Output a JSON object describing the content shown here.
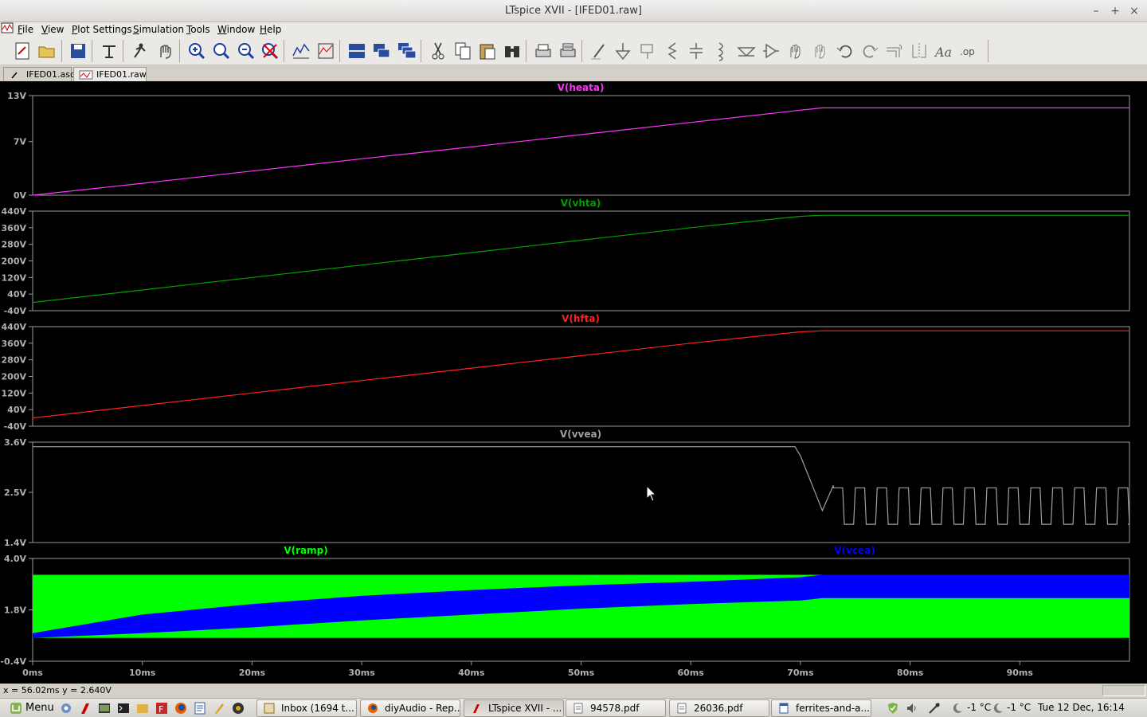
{
  "window": {
    "title": "LTspice XVII - [IFED01.raw]",
    "controls": [
      "–",
      "+",
      "×"
    ]
  },
  "menu": [
    "File",
    "View",
    "Plot Settings",
    "Simulation",
    "Tools",
    "Window",
    "Help"
  ],
  "tabs": [
    {
      "label": "IFED01.asc",
      "icon": "schematic-icon",
      "active": false
    },
    {
      "label": "IFED01.raw",
      "icon": "waveform-icon",
      "active": true
    }
  ],
  "toolbar_icons": [
    "new-schematic-icon",
    "open-icon",
    "save-icon",
    "control-panel-icon",
    "run-icon",
    "halt-icon",
    "zoom-in-icon",
    "zoom-area-icon",
    "zoom-out-icon",
    "zoom-fit-icon",
    "autorange-icon",
    "pick-traces-icon",
    "tile-horizontal-icon",
    "tile-vertical-icon",
    "cascade-icon",
    "cut-icon",
    "copy-icon",
    "paste-icon",
    "find-icon",
    "print-setup-icon",
    "print-icon",
    "wire-icon",
    "ground-icon",
    "label-net-icon",
    "resistor-icon",
    "capacitor-icon",
    "inductor-icon",
    "diode-icon",
    "component-icon",
    "move-icon",
    "drag-icon",
    "undo-icon",
    "redo-icon",
    "rotate-icon",
    "mirror-icon",
    "text-icon",
    "spice-directive-icon"
  ],
  "chart_data": [
    {
      "type": "line",
      "title": "V(heata)",
      "series": [
        {
          "name": "V(heata)",
          "color": "#ff33ff",
          "x": [
            0,
            10,
            20,
            30,
            40,
            50,
            60,
            70,
            72,
            100
          ],
          "y": [
            0,
            1.55,
            3.15,
            4.75,
            6.3,
            7.9,
            9.5,
            11.1,
            11.4,
            11.4
          ]
        }
      ],
      "ylim": [
        0,
        13
      ],
      "yticks": [
        "13V",
        "7V",
        "0V"
      ],
      "ytick_values": [
        13,
        7,
        0
      ],
      "xlim": [
        0,
        100
      ]
    },
    {
      "type": "line",
      "title": "V(vhta)",
      "series": [
        {
          "name": "V(vhta)",
          "color": "#00a000",
          "x": [
            0,
            10,
            20,
            30,
            40,
            50,
            60,
            70,
            72,
            100
          ],
          "y": [
            0,
            60,
            120,
            180,
            240,
            300,
            360,
            415,
            420,
            420
          ]
        }
      ],
      "ylim": [
        -40,
        440
      ],
      "yticks": [
        "440V",
        "360V",
        "280V",
        "200V",
        "120V",
        "40V",
        "-40V"
      ],
      "ytick_values": [
        440,
        360,
        280,
        200,
        120,
        40,
        -40
      ],
      "xlim": [
        0,
        100
      ]
    },
    {
      "type": "line",
      "title": "V(hfta)",
      "series": [
        {
          "name": "V(hfta)",
          "color": "#ff2020",
          "x": [
            0,
            10,
            20,
            30,
            40,
            50,
            60,
            70,
            72,
            100
          ],
          "y": [
            0,
            60,
            120,
            180,
            240,
            300,
            360,
            415,
            420,
            420
          ]
        }
      ],
      "ylim": [
        -40,
        440
      ],
      "yticks": [
        "440V",
        "360V",
        "280V",
        "200V",
        "120V",
        "40V",
        "-40V"
      ],
      "ytick_values": [
        440,
        360,
        280,
        200,
        120,
        40,
        -40
      ],
      "xlim": [
        0,
        100
      ]
    },
    {
      "type": "line",
      "title": "V(vvea)",
      "series": [
        {
          "name": "V(vvea)",
          "color": "#a0a0a0",
          "x": [
            0,
            69.5,
            70,
            71,
            71.5,
            72,
            73
          ],
          "y": [
            3.5,
            3.5,
            3.3,
            2.7,
            2.4,
            2.1,
            2.65
          ]
        }
      ],
      "square_wave": {
        "start": 73,
        "end": 100,
        "period": 2.0,
        "high": 2.6,
        "low": 1.8
      },
      "ylim": [
        1.4,
        3.6
      ],
      "yticks": [
        "3.6V",
        "2.5V",
        "1.4V"
      ],
      "ytick_values": [
        3.6,
        2.5,
        1.4
      ],
      "xlim": [
        0,
        100
      ]
    },
    {
      "type": "area",
      "title": "",
      "series": [
        {
          "name": "V(ramp)",
          "color": "#00ff00",
          "x": [
            0,
            100
          ],
          "y_high": [
            3.3,
            3.3
          ],
          "y_low": [
            0.6,
            0.6
          ]
        },
        {
          "name": "V(vcea)",
          "color": "#0000ff",
          "x": [
            0,
            10,
            20,
            30,
            40,
            50,
            60,
            70,
            72,
            100
          ],
          "y_low": [
            0.6,
            0.8,
            1.05,
            1.35,
            1.6,
            1.85,
            2.05,
            2.2,
            2.3,
            2.3
          ],
          "y_high": [
            0.8,
            1.6,
            2.05,
            2.4,
            2.65,
            2.85,
            3.0,
            3.2,
            3.3,
            3.3
          ]
        }
      ],
      "ylim": [
        -0.4,
        4.0
      ],
      "yticks": [
        "4.0V",
        "1.8V",
        "-0.4V"
      ],
      "ytick_values": [
        4.0,
        1.8,
        -0.4
      ],
      "xlim": [
        0,
        100
      ]
    }
  ],
  "x_axis": {
    "ticks": [
      "0ms",
      "10ms",
      "20ms",
      "30ms",
      "40ms",
      "50ms",
      "60ms",
      "70ms",
      "80ms",
      "90ms"
    ],
    "values": [
      0,
      10,
      20,
      30,
      40,
      50,
      60,
      70,
      80,
      90
    ],
    "xlim": [
      0,
      100
    ]
  },
  "statusbar": {
    "cursor": "x = 56.02ms    y = 2.640V"
  },
  "taskbar": {
    "menu_label": "Menu",
    "tasks": [
      {
        "label": "Inbox (1694 t...",
        "icon": "mail-icon",
        "active": false
      },
      {
        "label": "diyAudio - Rep...",
        "icon": "firefox-icon",
        "active": false
      },
      {
        "label": "LTspice XVII - ...",
        "icon": "ltspice-icon",
        "active": true
      },
      {
        "label": "94578.pdf",
        "icon": "pdf-icon",
        "active": false
      },
      {
        "label": "26036.pdf",
        "icon": "pdf-icon",
        "active": false
      },
      {
        "label": "ferrites-and-a...",
        "icon": "document-icon",
        "active": false
      }
    ],
    "weather1": "-1 °C",
    "weather2": "-1 °C",
    "clock": "Tue 12 Dec, 16:14"
  }
}
